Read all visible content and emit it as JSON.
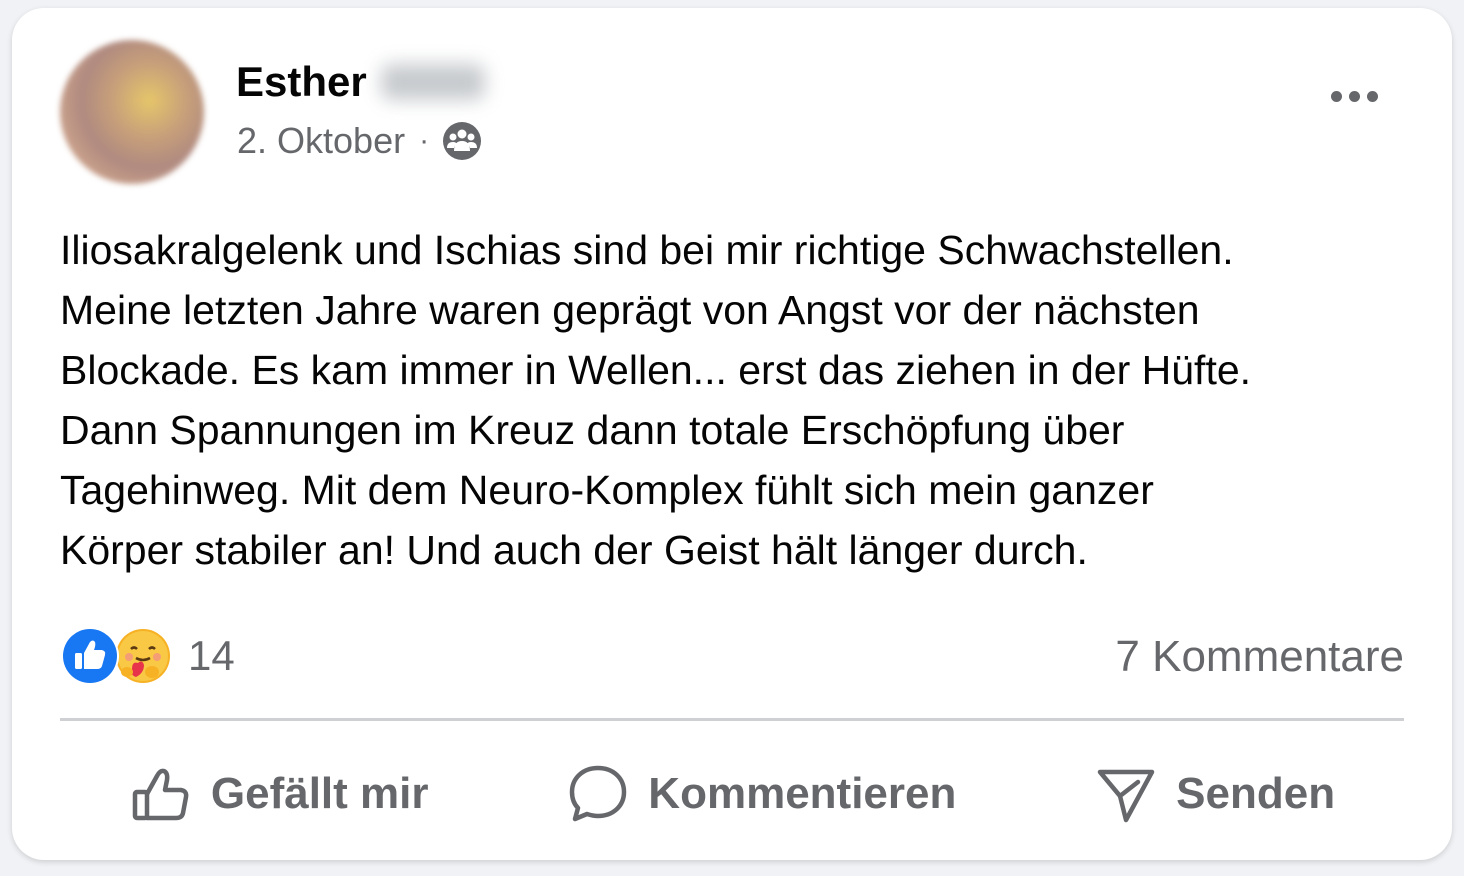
{
  "post": {
    "author": "Esther",
    "date": "2. Oktober",
    "separator": "·",
    "audience_icon": "group-icon",
    "text": "Iliosakralgelenk und Ischias sind bei mir richtige Schwachstellen.\nMeine letzten Jahre waren geprägt von Angst vor der nächsten\nBlockade. Es kam immer in Wellen... erst das ziehen in der Hüfte.\nDann Spannungen im Kreuz dann totale Erschöpfung über\nTagehinweg. Mit dem Neuro-Komplex fühlt sich mein ganzer\nKörper stabiler an! Und auch der Geist hält länger durch."
  },
  "reactions": {
    "icons": [
      "like-icon",
      "care-icon"
    ],
    "count": "14"
  },
  "comments_count": "7 Kommentare",
  "actions": {
    "like": "Gefällt mir",
    "comment": "Kommentieren",
    "share": "Senden"
  },
  "colors": {
    "accent": "#1877f2",
    "muted": "#65676b",
    "divider": "#ced0d4"
  }
}
